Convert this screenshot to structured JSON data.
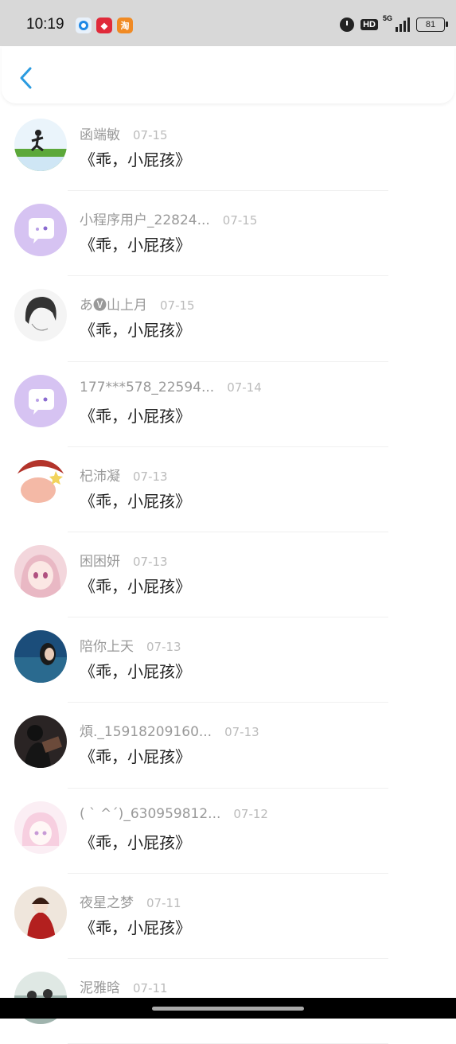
{
  "status": {
    "time": "10:19",
    "hd": "HD",
    "network": "5G",
    "battery": "81"
  },
  "header": {
    "back_icon": "chevron-left-icon",
    "accent": "#2b9be0"
  },
  "items": [
    {
      "name": "函端敏",
      "date": "07-15",
      "message": "《乖，小屁孩》",
      "avatar": "runner-photo"
    },
    {
      "name": "小程序用户_22824...",
      "date": "07-15",
      "message": "《乖，小屁孩》",
      "avatar": "default-chat-bubble"
    },
    {
      "name": "あ🅥山上月",
      "date": "07-15",
      "message": "《乖，小屁孩》",
      "avatar": "sketch-portrait"
    },
    {
      "name": "177***578_22594...",
      "date": "07-14",
      "message": "《乖，小屁孩》",
      "avatar": "default-chat-bubble"
    },
    {
      "name": "杞沛凝",
      "date": "07-13",
      "message": "《乖，小屁孩》",
      "avatar": "cartoon-fist"
    },
    {
      "name": "困困妍",
      "date": "07-13",
      "message": "《乖，小屁孩》",
      "avatar": "anime-girl"
    },
    {
      "name": "陪你上天",
      "date": "07-13",
      "message": "《乖，小屁孩》",
      "avatar": "ocean-girl"
    },
    {
      "name": "煩._15918209160...",
      "date": "07-13",
      "message": "《乖，小屁孩》",
      "avatar": "dark-figure"
    },
    {
      "name": "( ˋ ^ˊ)_630959812...",
      "date": "07-12",
      "message": "《乖，小屁孩》",
      "avatar": "pastel-anime"
    },
    {
      "name": "夜星之梦",
      "date": "07-11",
      "message": "《乖，小屁孩》",
      "avatar": "red-anime"
    },
    {
      "name": "泥雅晗",
      "date": "07-11",
      "message": "",
      "avatar": "group-photo"
    }
  ]
}
